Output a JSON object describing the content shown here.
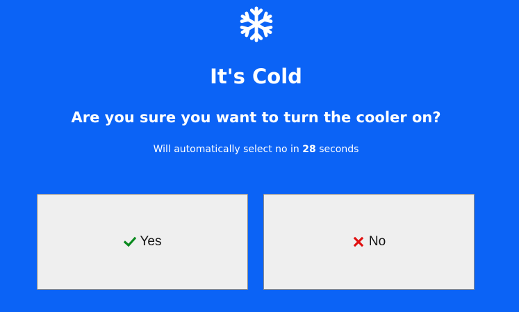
{
  "dialog": {
    "icon": "snowflake-icon",
    "title": "It's Cold",
    "question": "Are you sure you want to turn the cooler on?",
    "countdown_prefix": "Will automatically select no in ",
    "countdown_seconds": "28",
    "countdown_suffix": " seconds"
  },
  "buttons": {
    "yes": {
      "label": "Yes",
      "icon": "check-icon",
      "icon_color": "#0a8a1f"
    },
    "no": {
      "label": "No",
      "icon": "x-icon",
      "icon_color": "#e01010"
    }
  },
  "colors": {
    "background": "#0b63f6",
    "button_bg": "#efefef"
  }
}
